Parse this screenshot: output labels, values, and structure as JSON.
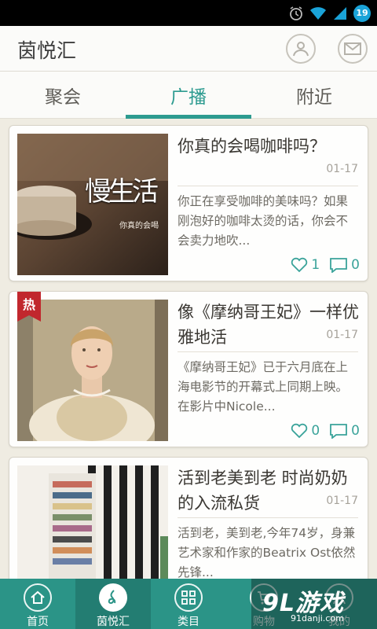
{
  "status_bar": {
    "battery": "19"
  },
  "header": {
    "title": "茵悦汇"
  },
  "tabs": [
    {
      "label": "聚会",
      "active": false
    },
    {
      "label": "广播",
      "active": true
    },
    {
      "label": "附近",
      "active": false
    }
  ],
  "cards": [
    {
      "title": "你真的会喝咖啡吗？",
      "date": "01-17",
      "desc": "你正在享受咖啡的美味吗？如果刚泡好的咖啡太烫的话，你会不会卖力地吹...",
      "likes": "1",
      "comments": "0",
      "hot": "",
      "thumb_text": {
        "main": "慢生活",
        "sub": "你真的会喝"
      }
    },
    {
      "title": "像《摩纳哥王妃》一样优雅地活",
      "date": "01-17",
      "desc": "《摩纳哥王妃》已于六月底在上海电影节的开幕式上同期上映。在影片中Nicole...",
      "likes": "0",
      "comments": "0",
      "hot": "热"
    },
    {
      "title": "活到老美到老 时尚奶奶的入流私货",
      "date": "01-17",
      "desc": "活到老，美到老,今年74岁，身兼艺术家和作家的Beatrix Ost依然先锋...",
      "likes": "",
      "comments": ""
    }
  ],
  "bottom_nav": [
    {
      "label": "首页",
      "icon": "home-icon",
      "active": false
    },
    {
      "label": "茵悦汇",
      "icon": "music-note-icon",
      "active": true
    },
    {
      "label": "类目",
      "icon": "grid-icon",
      "active": false
    },
    {
      "label": "购物",
      "icon": "cart-icon",
      "active": false
    },
    {
      "label": "我的",
      "icon": "user-icon",
      "active": false
    }
  ],
  "watermark": {
    "big": "9L游戏",
    "small": "91danji.com"
  },
  "colors": {
    "accent": "#2d9b90",
    "nav_bg": "#2b9487",
    "hot": "#c1272d"
  }
}
